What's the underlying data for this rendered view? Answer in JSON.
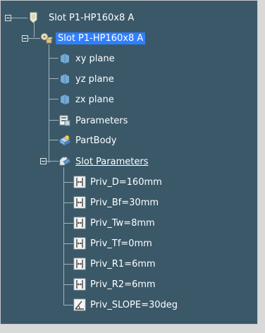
{
  "tree": {
    "root": {
      "label": "Slot P1-HP160x8 A",
      "icon": "part-icon"
    },
    "part": {
      "label": "Slot P1-HP160x8 A",
      "icon": "product-gear-icon",
      "selected": true
    },
    "children": [
      {
        "label": "xy plane",
        "icon": "plane-icon"
      },
      {
        "label": "yz plane",
        "icon": "plane-icon"
      },
      {
        "label": "zx plane",
        "icon": "plane-icon"
      },
      {
        "label": "Parameters",
        "icon": "parameters-icon"
      },
      {
        "label": "PartBody",
        "icon": "partbody-icon"
      },
      {
        "label": "Slot Parameters",
        "icon": "slot-parameters-icon"
      }
    ],
    "parameters": [
      {
        "label": "Priv_D=160mm",
        "icon": "length-parameter-icon"
      },
      {
        "label": "Priv_Bf=30mm",
        "icon": "length-parameter-icon"
      },
      {
        "label": "Priv_Tw=8mm",
        "icon": "length-parameter-icon"
      },
      {
        "label": "Priv_Tf=0mm",
        "icon": "length-parameter-icon"
      },
      {
        "label": "Priv_R1=6mm",
        "icon": "length-parameter-icon"
      },
      {
        "label": "Priv_R2=6mm",
        "icon": "length-parameter-icon"
      },
      {
        "label": "Priv_SLOPE=30deg",
        "icon": "angle-parameter-icon"
      }
    ]
  },
  "colors": {
    "background": "#3a5868",
    "selection": "#2f80ff",
    "text": "#ffffff"
  }
}
